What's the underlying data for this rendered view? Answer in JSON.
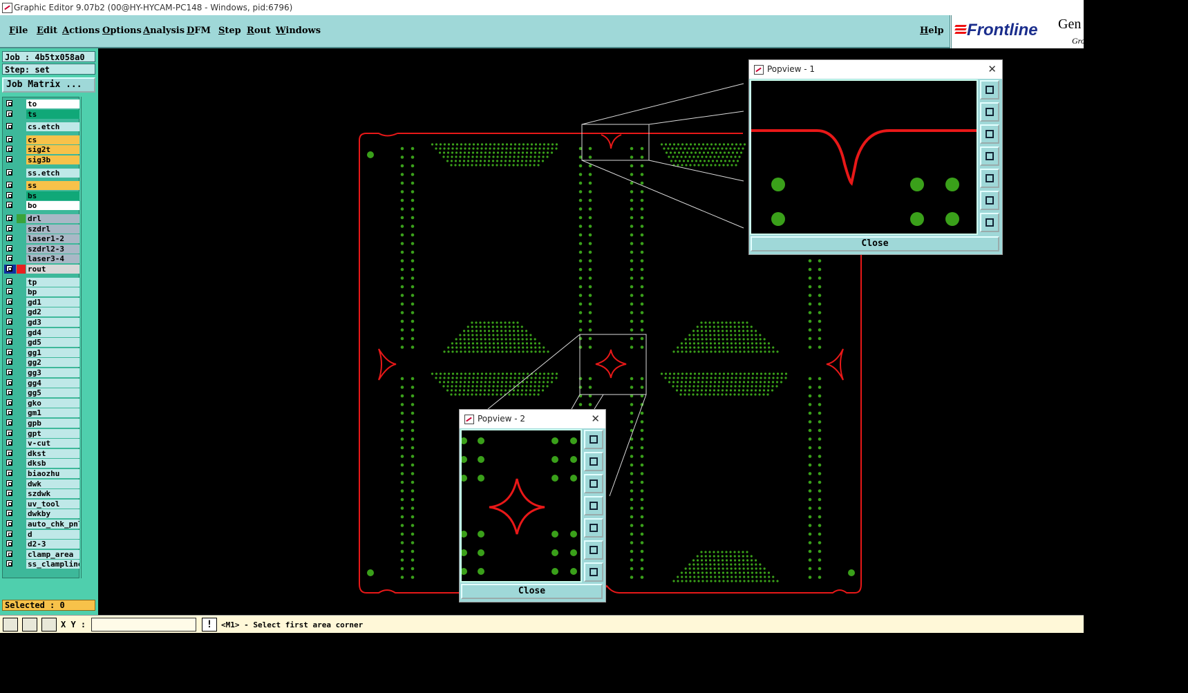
{
  "window": {
    "title": "Graphic Editor 9.07b2 (00@HY-HYCAM-PC148 - Windows, pid:6796)"
  },
  "menu": {
    "items": [
      "File",
      "Edit",
      "Actions",
      "Options",
      "Analysis",
      "DFM",
      "Step",
      "Rout",
      "Windows"
    ],
    "help": "Help"
  },
  "logo": {
    "brand": "Frontline",
    "suffix": "Gen",
    "sub": "Gro"
  },
  "left_panel": {
    "job": "Job : 4b5tx058a0",
    "step": "Step: set",
    "job_matrix": "Job Matrix ...",
    "selected": "Selected : 0",
    "layers": [
      {
        "name": "to",
        "bg": "#ffffff"
      },
      {
        "name": "ts",
        "bg": "#10a878"
      },
      {
        "name": "cs.etch",
        "bg": "#bfe8e8"
      },
      {
        "name": "cs",
        "bg": "#f7c24a"
      },
      {
        "name": "sig2t",
        "bg": "#f7c24a"
      },
      {
        "name": "sig3b",
        "bg": "#f7c24a"
      },
      {
        "name": "ss.etch",
        "bg": "#bfe8e8"
      },
      {
        "name": "ss",
        "bg": "#f7c24a"
      },
      {
        "name": "bs",
        "bg": "#10a878"
      },
      {
        "name": "bo",
        "bg": "#ffffff"
      },
      {
        "name": "drl",
        "bg": "#a9b8c6",
        "swatch": "#3aa33a"
      },
      {
        "name": "szdrl",
        "bg": "#a9b8c6"
      },
      {
        "name": "laser1-2",
        "bg": "#a9b8c6"
      },
      {
        "name": "szdrl2-3",
        "bg": "#a9b8c6"
      },
      {
        "name": "laser3-4",
        "bg": "#a9b8c6"
      },
      {
        "name": "rout",
        "bg": "#d8d8d8",
        "swatch": "#e82020",
        "active": true
      },
      {
        "name": "tp",
        "bg": "#bfe8e8"
      },
      {
        "name": "bp",
        "bg": "#bfe8e8"
      },
      {
        "name": "gd1",
        "bg": "#bfe8e8"
      },
      {
        "name": "gd2",
        "bg": "#bfe8e8"
      },
      {
        "name": "gd3",
        "bg": "#bfe8e8"
      },
      {
        "name": "gd4",
        "bg": "#bfe8e8"
      },
      {
        "name": "gd5",
        "bg": "#bfe8e8"
      },
      {
        "name": "gg1",
        "bg": "#bfe8e8"
      },
      {
        "name": "gg2",
        "bg": "#bfe8e8"
      },
      {
        "name": "gg3",
        "bg": "#bfe8e8"
      },
      {
        "name": "gg4",
        "bg": "#bfe8e8"
      },
      {
        "name": "gg5",
        "bg": "#bfe8e8"
      },
      {
        "name": "gko",
        "bg": "#bfe8e8"
      },
      {
        "name": "gm1",
        "bg": "#bfe8e8"
      },
      {
        "name": "gpb",
        "bg": "#bfe8e8"
      },
      {
        "name": "gpt",
        "bg": "#bfe8e8"
      },
      {
        "name": "v-cut",
        "bg": "#bfe8e8"
      },
      {
        "name": "dkst",
        "bg": "#bfe8e8"
      },
      {
        "name": "dksb",
        "bg": "#bfe8e8"
      },
      {
        "name": "biaozhu",
        "bg": "#bfe8e8"
      },
      {
        "name": "dwk",
        "bg": "#bfe8e8"
      },
      {
        "name": "szdwk",
        "bg": "#bfe8e8"
      },
      {
        "name": "uv_tool",
        "bg": "#bfe8e8"
      },
      {
        "name": "dwkby",
        "bg": "#bfe8e8"
      },
      {
        "name": "auto_chk_pnl",
        "bg": "#bfe8e8"
      },
      {
        "name": "d",
        "bg": "#bfe8e8"
      },
      {
        "name": "d2-3",
        "bg": "#bfe8e8"
      },
      {
        "name": "clamp_area",
        "bg": "#bfe8e8"
      },
      {
        "name": "ss_clampline",
        "bg": "#bfe8e8"
      }
    ]
  },
  "status_bar": {
    "xy_label": "X Y :",
    "xy_value": "",
    "warn_icon": "!",
    "prompt": "<M1> - Select first area corner"
  },
  "popview1": {
    "title": "Popview - 1",
    "close_label": "Close"
  },
  "popview2": {
    "title": "Popview - 2",
    "close_label": "Close"
  },
  "colors": {
    "rout": "#e81818",
    "pad": "#3aa01a",
    "accent": "#9fd8d8"
  }
}
